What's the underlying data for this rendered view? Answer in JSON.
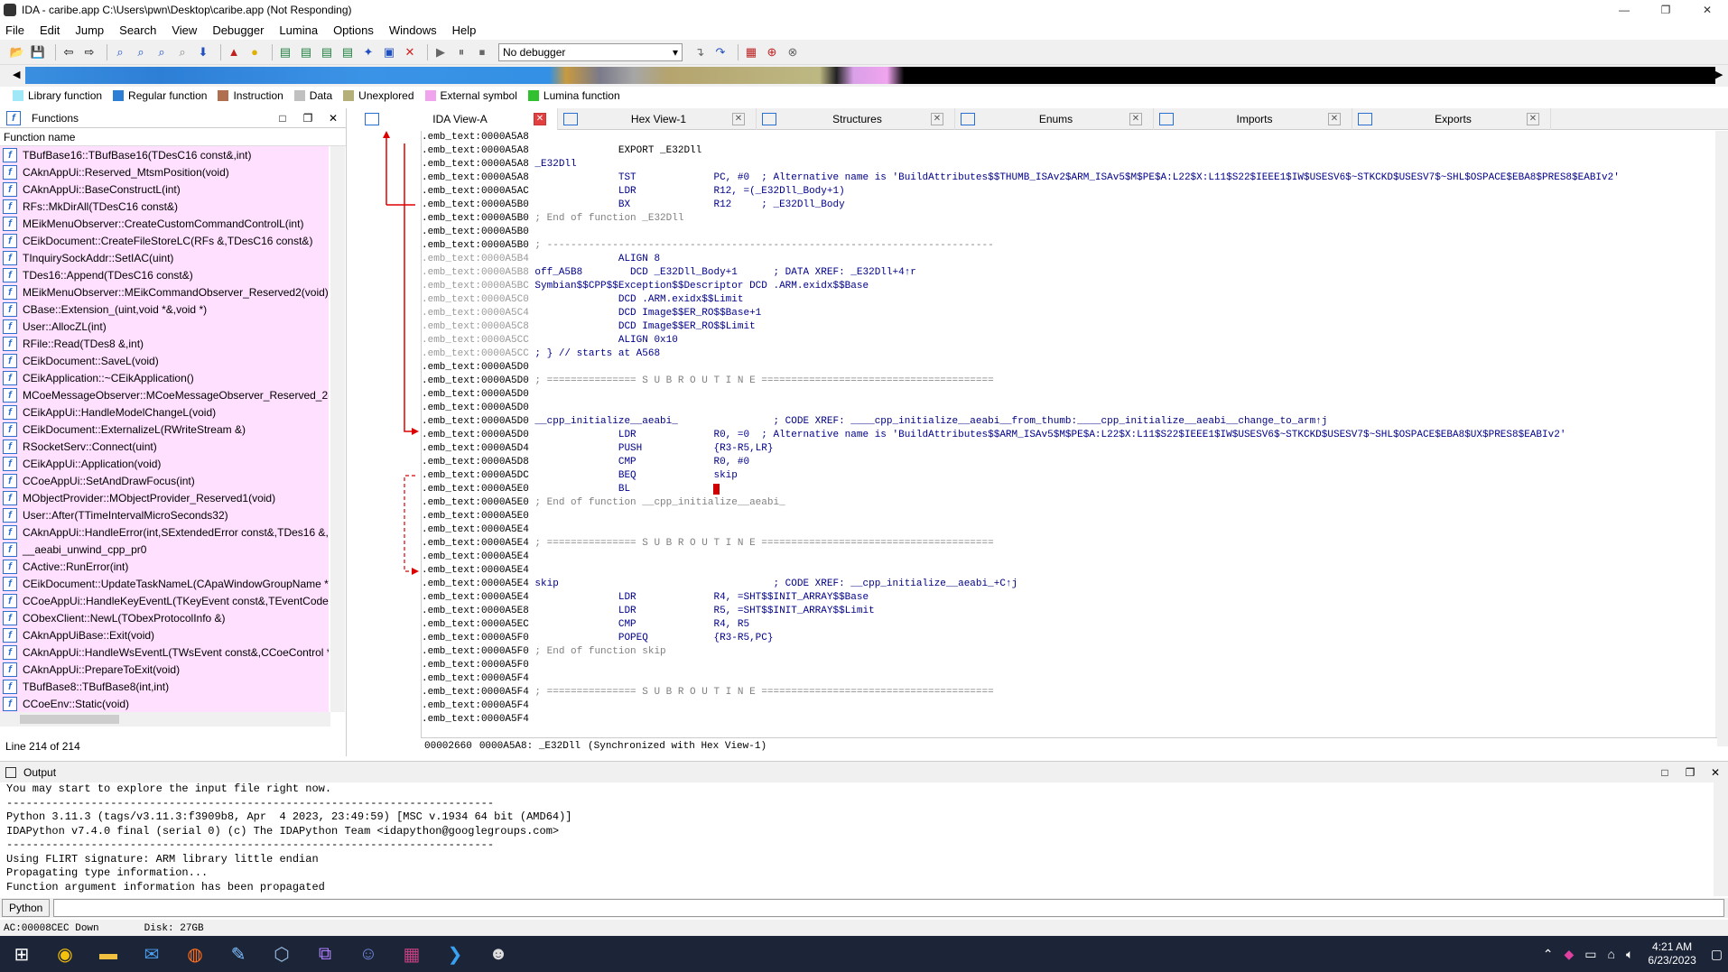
{
  "window": {
    "title": "IDA - caribe.app C:\\Users\\pwn\\Desktop\\caribe.app (Not Responding)",
    "min": "—",
    "max": "❐",
    "close": "✕"
  },
  "menu": [
    "File",
    "Edit",
    "Jump",
    "Search",
    "View",
    "Debugger",
    "Lumina",
    "Options",
    "Windows",
    "Help"
  ],
  "toolbar": {
    "debugger_select": "No debugger"
  },
  "legend": [
    {
      "label": "Library function",
      "color": "#a0e8f8"
    },
    {
      "label": "Regular function",
      "color": "#2d7fd6"
    },
    {
      "label": "Instruction",
      "color": "#b07050"
    },
    {
      "label": "Data",
      "color": "#c0c0c0"
    },
    {
      "label": "Unexplored",
      "color": "#b5b07a"
    },
    {
      "label": "External symbol",
      "color": "#f0a4ee"
    },
    {
      "label": "Lumina function",
      "color": "#30c030"
    }
  ],
  "functions": {
    "title": "Functions",
    "column": "Function name",
    "items": [
      "TBufBase16::TBufBase16(TDesC16 const&,int)",
      "CAknAppUi::Reserved_MtsmPosition(void)",
      "CAknAppUi::BaseConstructL(int)",
      "RFs::MkDirAll(TDesC16 const&)",
      "MEikMenuObserver::CreateCustomCommandControlL(int)",
      "CEikDocument::CreateFileStoreLC(RFs &,TDesC16 const&)",
      "TInquirySockAddr::SetIAC(uint)",
      "TDes16::Append(TDesC16 const&)",
      "MEikMenuObserver::MEikCommandObserver_Reserved2(void)",
      "CBase::Extension_(uint,void *&,void *)",
      "User::AllocZL(int)",
      "RFile::Read(TDes8 &,int)",
      "CEikDocument::SaveL(void)",
      "CEikApplication::~CEikApplication()",
      "MCoeMessageObserver::MCoeMessageObserver_Reserved_2(voi",
      "CEikAppUi::HandleModelChangeL(void)",
      "CEikDocument::ExternalizeL(RWriteStream &)",
      "RSocketServ::Connect(uint)",
      "CEikAppUi::Application(void)",
      "CCoeAppUi::SetAndDrawFocus(int)",
      "MObjectProvider::MObjectProvider_Reserved1(void)",
      "User::After(TTimeIntervalMicroSeconds32)",
      "CAknAppUi::HandleError(int,SExtendedError const&,TDes16 &,TI",
      "__aeabi_unwind_cpp_pr0",
      "CActive::RunError(int)",
      "CEikDocument::UpdateTaskNameL(CApaWindowGroupName *)",
      "CCoeAppUi::HandleKeyEventL(TKeyEvent const&,TEventCode)",
      "CObexClient::NewL(TObexProtocolInfo &)",
      "CAknAppUiBase::Exit(void)",
      "CAknAppUi::HandleWsEventL(TWsEvent const&,CCoeControl *)",
      "CAknAppUi::PrepareToExit(void)",
      "TBufBase8::TBufBase8(int,int)",
      "CCoeEnv::Static(void)"
    ],
    "status": "Line 214 of 214"
  },
  "tabs": [
    {
      "label": "IDA View-A",
      "active": true
    },
    {
      "label": "Hex View-1",
      "active": false
    },
    {
      "label": "Structures",
      "active": false
    },
    {
      "label": "Enums",
      "active": false
    },
    {
      "label": "Imports",
      "active": false
    },
    {
      "label": "Exports",
      "active": false
    }
  ],
  "disasm": [
    [
      ".emb_text:0000A5A8",
      "",
      ""
    ],
    [
      ".emb_text:0000A5A8",
      "               EXPORT _E32Dll",
      ""
    ],
    [
      ".emb_text:0000A5A8",
      " _E32Dll",
      "sym"
    ],
    [
      ".emb_text:0000A5A8",
      "               TST             PC, #0  ; Alternative name is 'BuildAttributes$$THUMB_ISAv2$ARM_ISAv5$M$PE$A:L22$X:L11$S22$IEEE1$IW$USESV6$~STKCKD$USESV7$~SHL$OSPACE$EBA8$PRES8$EABIv2'",
      "ins"
    ],
    [
      ".emb_text:0000A5AC",
      "               LDR             R12, =(_E32Dll_Body+1)",
      "ins"
    ],
    [
      ".emb_text:0000A5B0",
      "               BX              R12     ; _E32Dll_Body",
      "ins"
    ],
    [
      ".emb_text:0000A5B0",
      " ; End of function _E32Dll",
      "cmt"
    ],
    [
      ".emb_text:0000A5B0",
      "",
      ""
    ],
    [
      ".emb_text:0000A5B0",
      " ; ---------------------------------------------------------------------------",
      "cmt"
    ],
    [
      ".emb_text:0000A5B4",
      "               ALIGN 8",
      "gins"
    ],
    [
      ".emb_text:0000A5B8",
      " off_A5B8        DCD _E32Dll_Body+1      ; DATA XREF: _E32Dll+4↑r",
      "gins"
    ],
    [
      ".emb_text:0000A5BC",
      " Symbian$$CPP$$Exception$$Descriptor DCD .ARM.exidx$$Base",
      "gins"
    ],
    [
      ".emb_text:0000A5C0",
      "               DCD .ARM.exidx$$Limit",
      "gins"
    ],
    [
      ".emb_text:0000A5C4",
      "               DCD Image$$ER_RO$$Base+1",
      "gins"
    ],
    [
      ".emb_text:0000A5C8",
      "               DCD Image$$ER_RO$$Limit",
      "gins"
    ],
    [
      ".emb_text:0000A5CC",
      "               ALIGN 0x10",
      "gins"
    ],
    [
      ".emb_text:0000A5CC",
      " ; } // starts at A568",
      "gins"
    ],
    [
      ".emb_text:0000A5D0",
      "",
      ""
    ],
    [
      ".emb_text:0000A5D0",
      " ; =============== S U B R O U T I N E =======================================",
      "cmt"
    ],
    [
      ".emb_text:0000A5D0",
      "",
      ""
    ],
    [
      ".emb_text:0000A5D0",
      "",
      ""
    ],
    [
      ".emb_text:0000A5D0",
      " __cpp_initialize__aeabi_                ; CODE XREF: ____cpp_initialize__aeabi__from_thumb:____cpp_initialize__aeabi__change_to_arm↑j",
      "sym"
    ],
    [
      ".emb_text:0000A5D0",
      "               LDR             R0, =0  ; Alternative name is 'BuildAttributes$$ARM_ISAv5$M$PE$A:L22$X:L11$S22$IEEE1$IW$USESV6$~STKCKD$USESV7$~SHL$OSPACE$EBA8$UX$PRES8$EABIv2'",
      "ins"
    ],
    [
      ".emb_text:0000A5D4",
      "               PUSH            {R3-R5,LR}",
      "ins"
    ],
    [
      ".emb_text:0000A5D8",
      "               CMP             R0, #0",
      "ins"
    ],
    [
      ".emb_text:0000A5DC",
      "               BEQ             skip",
      "ins"
    ],
    [
      ".emb_text:0000A5E0",
      "               BL              ",
      "bl"
    ],
    [
      ".emb_text:0000A5E0",
      " ; End of function __cpp_initialize__aeabi_",
      "cmt"
    ],
    [
      ".emb_text:0000A5E0",
      "",
      ""
    ],
    [
      ".emb_text:0000A5E4",
      "",
      ""
    ],
    [
      ".emb_text:0000A5E4",
      " ; =============== S U B R O U T I N E =======================================",
      "cmt"
    ],
    [
      ".emb_text:0000A5E4",
      "",
      ""
    ],
    [
      ".emb_text:0000A5E4",
      "",
      ""
    ],
    [
      ".emb_text:0000A5E4",
      " skip                                    ; CODE XREF: __cpp_initialize__aeabi_+C↑j",
      "sym"
    ],
    [
      ".emb_text:0000A5E4",
      "               LDR             R4, =SHT$$INIT_ARRAY$$Base",
      "ins"
    ],
    [
      ".emb_text:0000A5E8",
      "               LDR             R5, =SHT$$INIT_ARRAY$$Limit",
      "ins"
    ],
    [
      ".emb_text:0000A5EC",
      "               CMP             R4, R5",
      "ins"
    ],
    [
      ".emb_text:0000A5F0",
      "               POPEQ           {R3-R5,PC}",
      "ins"
    ],
    [
      ".emb_text:0000A5F0",
      " ; End of function skip",
      "cmt"
    ],
    [
      ".emb_text:0000A5F0",
      "",
      ""
    ],
    [
      ".emb_text:0000A5F4",
      "",
      ""
    ],
    [
      ".emb_text:0000A5F4",
      " ; =============== S U B R O U T I N E =======================================",
      "cmt"
    ],
    [
      ".emb_text:0000A5F4",
      "",
      ""
    ],
    [
      ".emb_text:0000A5F4",
      "",
      ""
    ]
  ],
  "disasm_status": {
    "offset": "00002660",
    "location": "0000A5A8: _E32Dll",
    "sync": "(Synchronized with Hex View-1)"
  },
  "output": {
    "title": "Output",
    "lines": [
      "You may start to explore the input file right now.",
      "---------------------------------------------------------------------------",
      "Python 3.11.3 (tags/v3.11.3:f3909b8, Apr  4 2023, 23:49:59) [MSC v.1934 64 bit (AMD64)]",
      "IDAPython v7.4.0 final (serial 0) (c) The IDAPython Team <idapython@googlegroups.com>",
      "---------------------------------------------------------------------------",
      "Using FLIRT signature: ARM library little endian",
      "Propagating type information...",
      "Function argument information has been propagated"
    ],
    "python_button": "Python"
  },
  "statusbar": {
    "ac": "AC:00008CEC Down",
    "disk": "Disk: 27GB"
  },
  "taskbar": {
    "time": "4:21 AM",
    "date": "6/23/2023"
  }
}
